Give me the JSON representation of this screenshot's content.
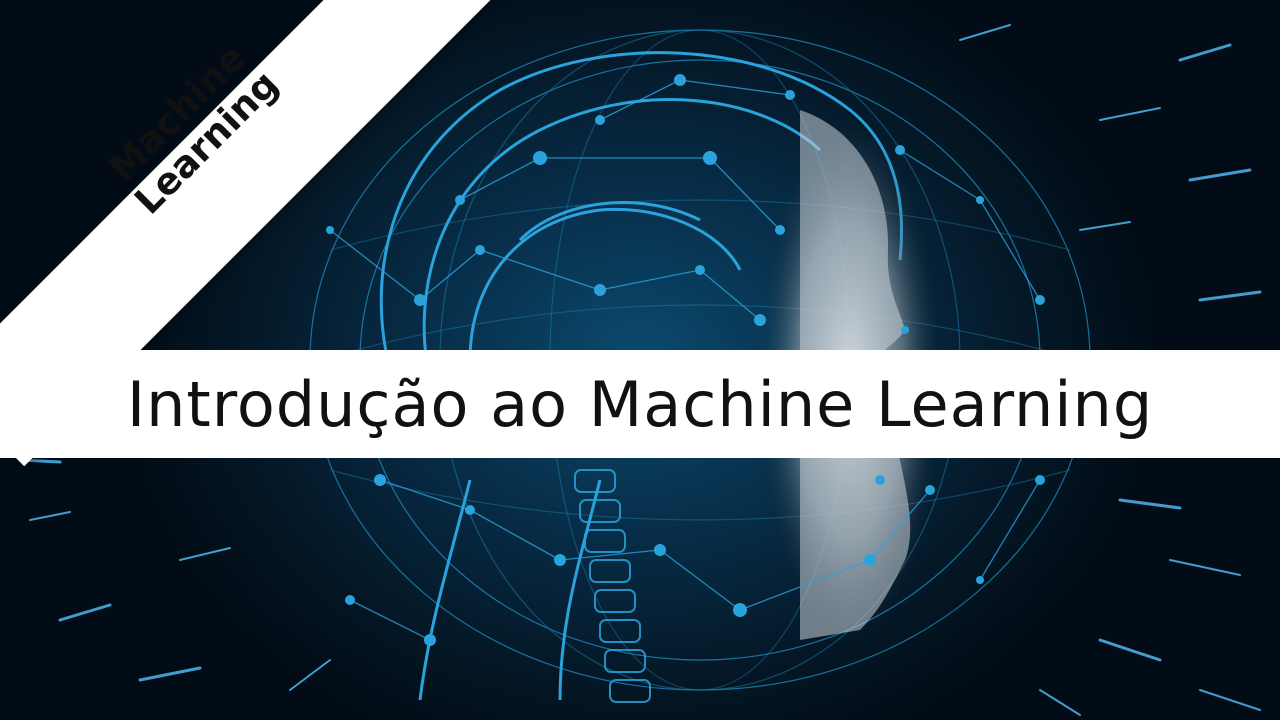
{
  "thumbnail": {
    "corner_banner": {
      "line1": "Machine",
      "line2": "Learning"
    },
    "title": "Introdução ao Machine Learning"
  },
  "colors": {
    "background_dark": "#04121f",
    "network_blue": "#1e8fc7",
    "band_white": "#ffffff",
    "text_dark": "#111111"
  }
}
